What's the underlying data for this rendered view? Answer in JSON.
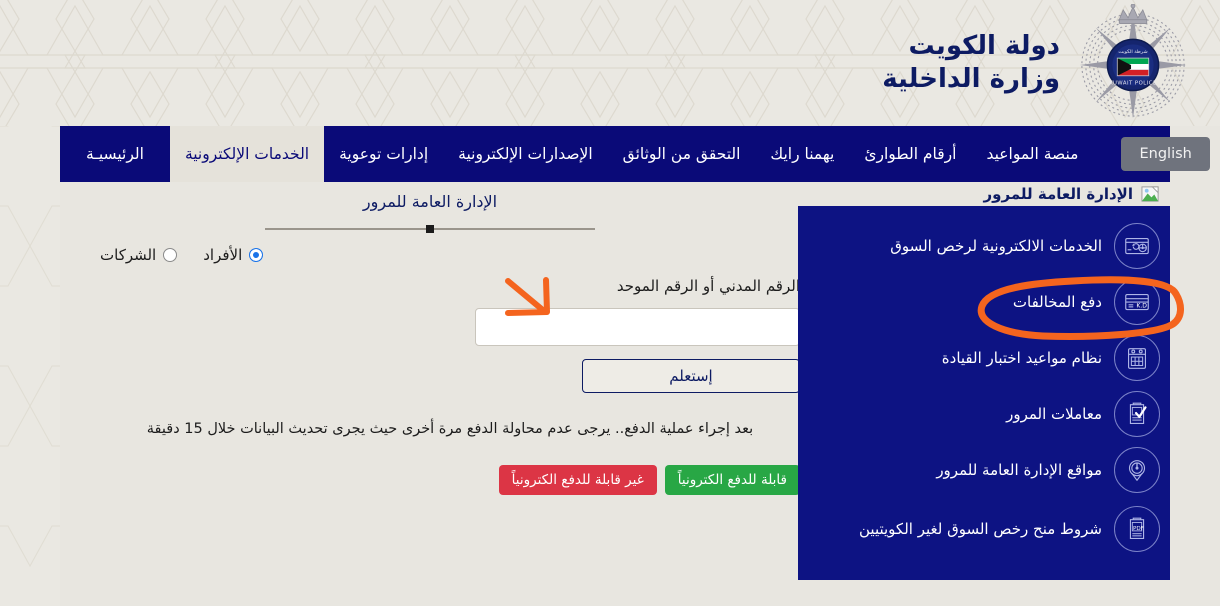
{
  "header": {
    "brand_line1": "دولة الكويت",
    "brand_line2": "وزارة الداخلية",
    "logo_name": "kuwait-police-emblem",
    "logo_text_en": "KUWAIT POLICE",
    "logo_text_ar": "شرطة الكويت"
  },
  "nav": {
    "language_button": "English",
    "items": [
      {
        "label": "الرئيسيـة",
        "active": false
      },
      {
        "label": "الخدمات الإلكترونية",
        "active": true
      },
      {
        "label": "إدارات توعوية",
        "active": false
      },
      {
        "label": "الإصدارات الإلكترونية",
        "active": false
      },
      {
        "label": "التحقق من الوثائق",
        "active": false
      },
      {
        "label": "يهمنا رايك",
        "active": false
      },
      {
        "label": "أرقام الطوارئ",
        "active": false
      },
      {
        "label": "منصة المواعيد",
        "active": false
      }
    ]
  },
  "main": {
    "section_title": "الإدارة العامة للمرور",
    "radios": [
      {
        "label": "الأفراد",
        "checked": true
      },
      {
        "label": "الشركات",
        "checked": false
      }
    ],
    "field_label": "الرقم المدني أو الرقم الموحد",
    "input_value": "",
    "input_placeholder": "",
    "submit_label": "إستعلم",
    "note": "بعد إجراء عملية الدفع.. يرجى عدم محاولة الدفع مرة أخرى حيث يجرى تحديث البيانات خلال 15 دقيقة",
    "legend": [
      {
        "label": "قابلة للدفع الكترونياً",
        "color": "#28a745"
      },
      {
        "label": "غير قابلة للدفع الكترونياً",
        "color": "#dc3545"
      }
    ]
  },
  "sidebar": {
    "heading": "الإدارة العامة للمرور",
    "heading_icon": "broken-image-icon",
    "items": [
      {
        "label": "الخدمات الالكترونية لرخص السوق",
        "icon": "license-card-icon"
      },
      {
        "label": "دفع المخالفات",
        "icon": "payment-card-kd-icon",
        "highlighted": true
      },
      {
        "label": "نظام مواعيد اختبار القيادة",
        "icon": "calendar-icon"
      },
      {
        "label": "معاملات المرور",
        "icon": "document-check-icon"
      },
      {
        "label": "مواقع الإدارة العامة للمرور",
        "icon": "location-pin-icon"
      },
      {
        "label": "شروط منح رخص السوق لغير الكويتيين",
        "icon": "pdf-document-icon"
      }
    ]
  },
  "annotations": {
    "circle_target": "دفع المخالفات",
    "arrow_target": "الرقم المدني أو الرقم الموحد",
    "color": "#f4641e"
  },
  "colors": {
    "navy": "#0a0a78",
    "sidebar_navy": "#0d1383",
    "page_bg": "#e8e6e0",
    "brand_blue": "#0d1b63",
    "accent_orange": "#f4641e",
    "green": "#28a745",
    "red": "#dc3545",
    "english_btn": "#6f737d"
  }
}
